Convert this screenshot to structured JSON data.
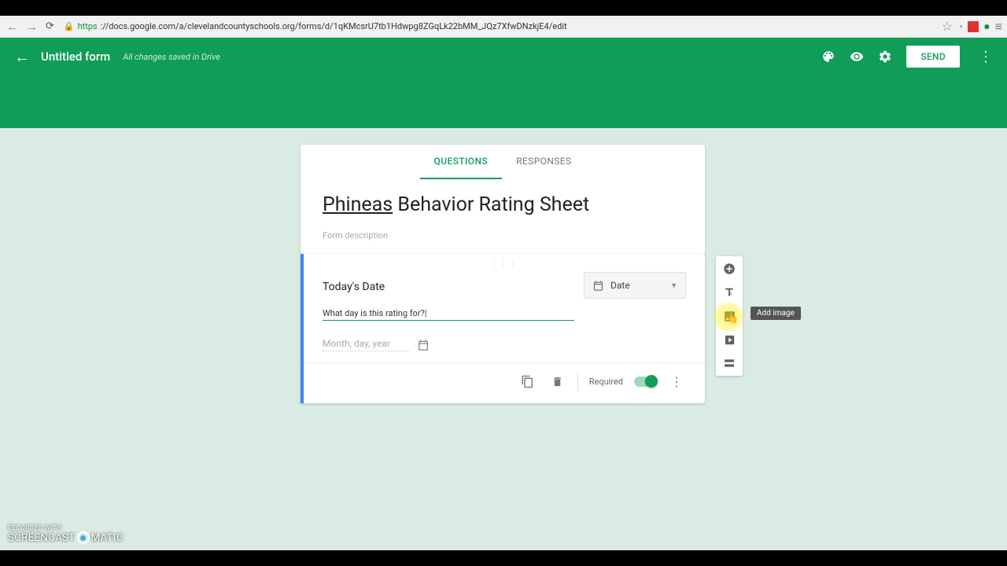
{
  "browser": {
    "url_prefix": "https",
    "url": "://docs.google.com/a/clevelandcountyschools.org/forms/d/1qKMcsrU7tb1Hdwpg8ZGqLk22bMM_JQz7XfwDNzkjE4/edit"
  },
  "header": {
    "doc_title": "Untitled form",
    "save_status": "All changes saved in Drive",
    "send_label": "SEND"
  },
  "tabs": {
    "questions": "QUESTIONS",
    "responses": "RESPONSES"
  },
  "form": {
    "title_underlined": "Phineas",
    "title_rest": " Behavior Rating Sheet",
    "description_placeholder": "Form description"
  },
  "question": {
    "title": "Today's Date",
    "description": "What day is this rating for?",
    "type_label": "Date",
    "date_placeholder": "Month, day, year",
    "required_label": "Required"
  },
  "tooltip": {
    "add_image": "Add image"
  },
  "watermark": {
    "line1": "RECORDED WITH",
    "brand1": "SCREENCAST",
    "brand2": "MATIC"
  }
}
